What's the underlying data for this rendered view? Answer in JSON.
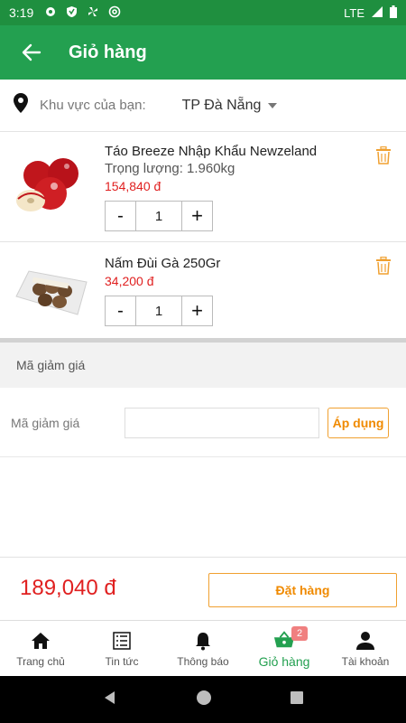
{
  "status_bar": {
    "time": "3:19",
    "network": "LTE",
    "icons": [
      "gear-icon",
      "shield-icon",
      "fan-icon",
      "at-icon",
      "signal-icon",
      "battery-icon"
    ]
  },
  "app_bar": {
    "title": "Giỏ hàng",
    "back_icon": "arrow-left-icon"
  },
  "region": {
    "icon": "location-pin-icon",
    "label": "Khu vực của bạn:",
    "selected": "TP Đà Nẵng"
  },
  "cart": {
    "items": [
      {
        "name": "Táo Breeze Nhập Khẩu Newzeland",
        "weight": "Trọng lượng: 1.960kg",
        "price": "154,840 đ",
        "quantity": "1",
        "minus": "-",
        "plus": "+",
        "image": "red-apple-image"
      },
      {
        "name": "Nấm Đùi Gà 250Gr",
        "price": "34,200 đ",
        "quantity": "1",
        "minus": "-",
        "plus": "+",
        "image": "mushroom-tray-image"
      }
    ]
  },
  "discount": {
    "header": "Mã giảm giá",
    "label": "Mã giảm giá",
    "input_value": "",
    "apply": "Áp dụng"
  },
  "footer": {
    "total": "189,040 đ",
    "order": "Đặt hàng"
  },
  "bottom_nav": {
    "items": [
      {
        "label": "Trang chủ",
        "icon": "home-icon"
      },
      {
        "label": "Tin tức",
        "icon": "news-list-icon"
      },
      {
        "label": "Thông báo",
        "icon": "bell-icon"
      },
      {
        "label": "Giỏ hàng",
        "icon": "basket-icon",
        "badge": "2",
        "active": true
      },
      {
        "label": "Tài khoản",
        "icon": "user-icon"
      }
    ]
  },
  "colors": {
    "primary": "#23a050",
    "status_bar": "#1f8f3f",
    "price": "#e02020",
    "accent": "#f08a00",
    "badge": "#f08080"
  }
}
